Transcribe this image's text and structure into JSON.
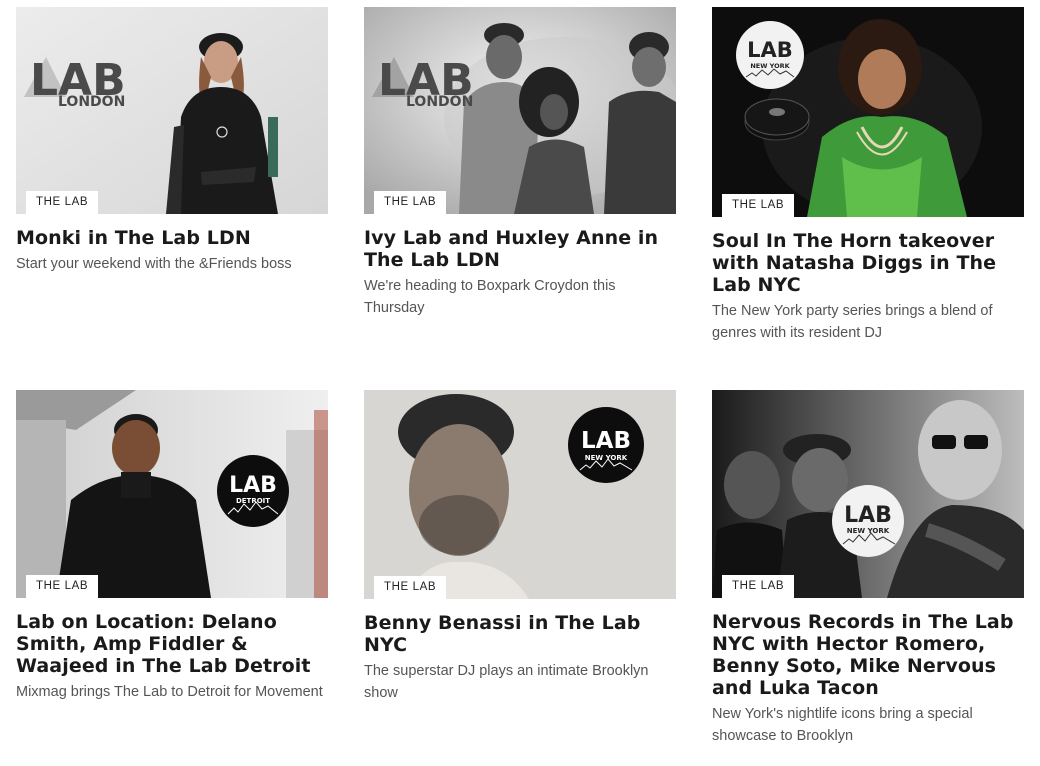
{
  "cards": [
    {
      "tag": "THE LAB",
      "title": "Monki in The Lab LDN",
      "description": "Start your weekend with the &Friends boss",
      "logo": {
        "main": "LAB",
        "sub": "LONDON"
      }
    },
    {
      "tag": "THE LAB",
      "title": "Ivy Lab and Huxley Anne in The Lab LDN",
      "description": "We're heading to Boxpark Croydon this Thursday",
      "logo": {
        "main": "LAB",
        "sub": "LONDON"
      }
    },
    {
      "tag": "THE LAB",
      "title": "Soul In The Horn takeover with Natasha Diggs in The Lab NYC",
      "description": "The New York party series brings a blend of genres with its resident DJ",
      "logo": {
        "main": "LAB",
        "sub": "NEW YORK"
      }
    },
    {
      "tag": "THE LAB",
      "title": "Lab on Location: Delano Smith, Amp Fiddler & Waajeed in The Lab Detroit",
      "description": "Mixmag brings The Lab to Detroit for Movement",
      "logo": {
        "main": "LAB",
        "sub": "DETROIT"
      }
    },
    {
      "tag": "THE LAB",
      "title": "Benny Benassi in The Lab NYC",
      "description": "The superstar DJ plays an intimate Brooklyn show",
      "logo": {
        "main": "LAB",
        "sub": "NEW YORK"
      }
    },
    {
      "tag": "THE LAB",
      "title": "Nervous Records in The Lab NYC with Hector Romero, Benny Soto, Mike Nervous and Luka Tacon",
      "description": "New York's nightlife icons bring a special showcase to Brooklyn",
      "logo": {
        "main": "LAB",
        "sub": "NEW YORK"
      }
    }
  ]
}
